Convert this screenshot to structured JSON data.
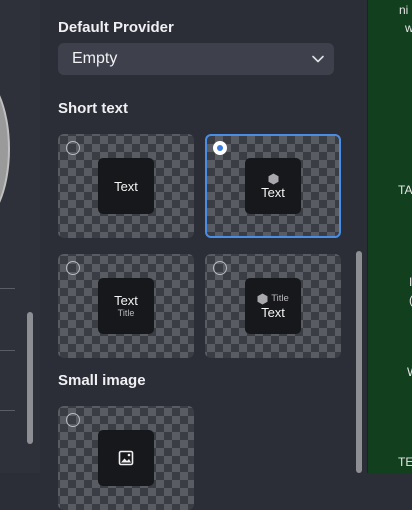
{
  "provider": {
    "heading": "Default Provider",
    "selected_value": "Empty"
  },
  "short_text": {
    "heading": "Short text",
    "options": [
      {
        "text": "Text",
        "selected": false
      },
      {
        "text": "Text",
        "selected": true,
        "icon": "hexagon-icon"
      },
      {
        "text": "Text",
        "title": "Title",
        "selected": false
      },
      {
        "text": "Text",
        "title": "Title",
        "selected": false,
        "icon": "hexagon-icon"
      }
    ]
  },
  "small_image": {
    "heading": "Small image",
    "options": [
      {
        "icon": "image-icon",
        "selected": false
      }
    ]
  },
  "right_panel": {
    "fragments": [
      "ni",
      "w",
      "TA",
      "I",
      "(",
      "W",
      "TE"
    ]
  },
  "colors": {
    "accent": "#4a8de6",
    "panel_bg": "#2b2e37",
    "dropdown_bg": "#3e414b",
    "right_bg": "#12401f"
  }
}
